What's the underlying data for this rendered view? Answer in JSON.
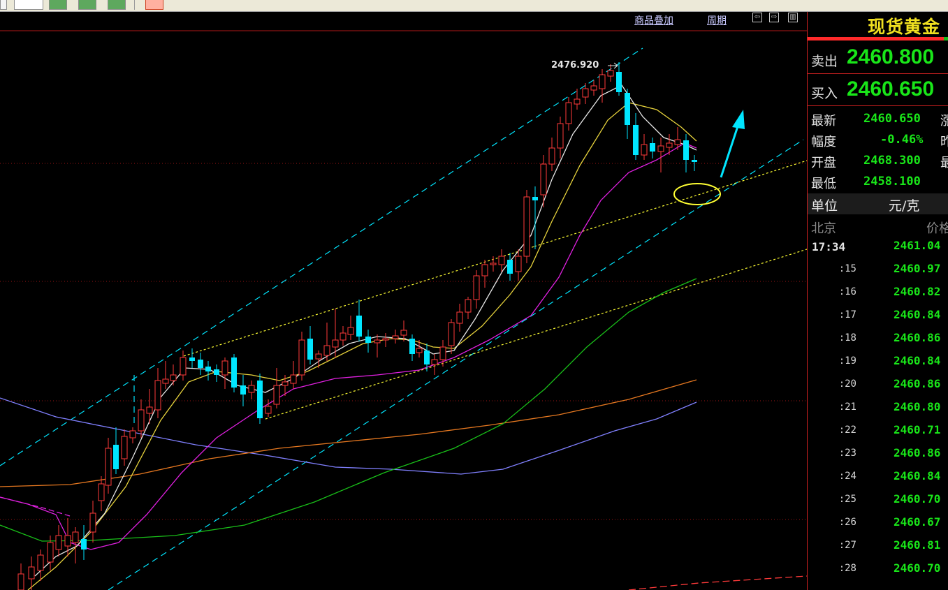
{
  "chart_toolbar": {
    "overlay_label": "商品叠加",
    "period_label": "周期",
    "nav_icons": [
      "scroll-left-icon",
      "scroll-right-icon",
      "panel-toggle-icon"
    ]
  },
  "chart_annotation": {
    "peak_label": "2476.920"
  },
  "colors": {
    "up_candle": "#ff3a3a",
    "down_candle": "#00e6ff",
    "trend_channel": "#00e6ff",
    "dotted_trend": "#ffff33",
    "ma_white": "#e6e6e6",
    "ma_yellow": "#e6d23c",
    "ma_magenta": "#e020e0",
    "ma_green": "#19c019",
    "ma_orange": "#e67820",
    "ma_purple": "#8080ff"
  },
  "panel": {
    "title": "现货黄金",
    "sell_label": "卖出",
    "sell_value": "2460.800",
    "buy_label": "买入",
    "buy_value": "2460.650",
    "stats": [
      {
        "label": "最新",
        "value": "2460.650",
        "cut": "涨"
      },
      {
        "label": "幅度",
        "value": "-0.46%",
        "cut": "昨"
      },
      {
        "label": "开盘",
        "value": "2468.300",
        "cut": "最"
      },
      {
        "label": "最低",
        "value": "2458.100",
        "cut": ""
      }
    ],
    "unit_label": "单位",
    "unit_value": "元/克",
    "city": "北京",
    "price_header": "价格",
    "ticks": [
      {
        "time": "17:34",
        "price": "2461.04"
      },
      {
        "time": ":15",
        "price": "2460.97"
      },
      {
        "time": ":16",
        "price": "2460.82"
      },
      {
        "time": ":17",
        "price": "2460.84"
      },
      {
        "time": ":18",
        "price": "2460.86"
      },
      {
        "time": ":19",
        "price": "2460.84"
      },
      {
        "time": ":20",
        "price": "2460.86"
      },
      {
        "time": ":21",
        "price": "2460.80"
      },
      {
        "time": ":22",
        "price": "2460.71"
      },
      {
        "time": ":23",
        "price": "2460.86"
      },
      {
        "time": ":24",
        "price": "2460.84"
      },
      {
        "time": ":25",
        "price": "2460.70"
      },
      {
        "time": ":26",
        "price": "2460.67"
      },
      {
        "time": ":27",
        "price": "2460.81"
      },
      {
        "time": ":28",
        "price": "2460.70"
      }
    ]
  }
}
